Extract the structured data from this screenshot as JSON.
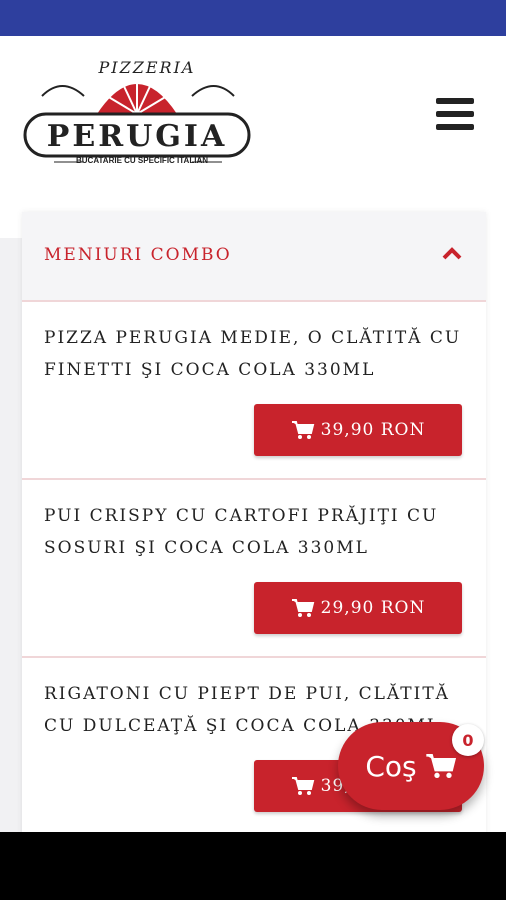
{
  "brand": {
    "script": "PIZZERIA",
    "name": "PERUGIA",
    "tagline": "BUCATARIE CU SPECIFIC ITALIAN",
    "accent": "#c8232c"
  },
  "header": {
    "menu_icon": "hamburger-icon"
  },
  "section": {
    "title": "MENIURI COMBO",
    "toggle_icon": "chevron-up-icon"
  },
  "items": [
    {
      "desc": "PIZZA PERUGIA MEDIE, O CLĂTITĂ CU FINETTI ŞI COCA COLA 330ML",
      "price": "39,90 RON"
    },
    {
      "desc": "PUI CRISPY CU CARTOFI PRĂJIŢI CU SOSURI ŞI COCA COLA 330ML",
      "price": "29,90 RON"
    },
    {
      "desc": "RIGATONI CU PIEPT DE PUI, CLĂTITĂ CU DULCEAŢĂ ŞI COCA COLA 330ML",
      "price": "39,90 RON"
    }
  ],
  "cart": {
    "label": "Coş",
    "count": "0",
    "icon": "cart-icon"
  },
  "colors": {
    "statusbar": "#2e3f9e",
    "accent": "#c8232c"
  }
}
